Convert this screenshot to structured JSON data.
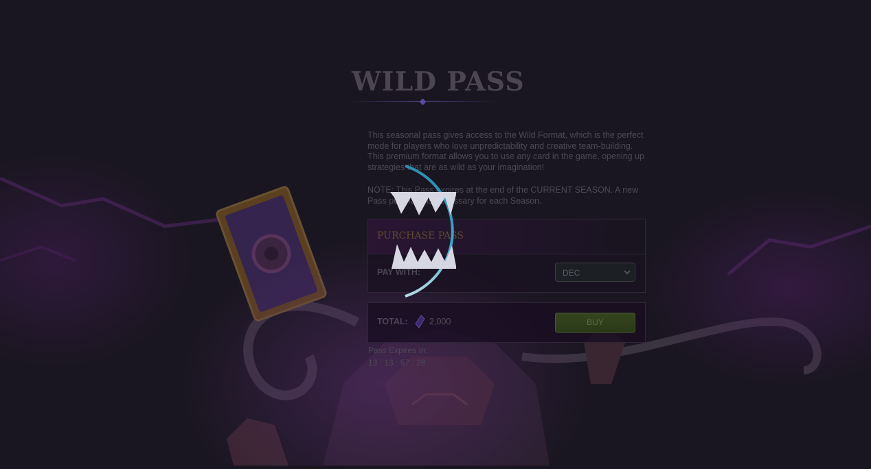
{
  "page": {
    "title": "WILD PASS",
    "description": "This seasonal pass gives access to the Wild Format, which is the perfect mode for players who love unpredictability and creative team-building. This premium format allows you to use any card in the game, opening up strategies that are as wild as your imagination!",
    "note": "NOTE: This Pass expires at the end of the CURRENT SEASON. A new Pass purchase is necessary for each Season."
  },
  "purchase": {
    "header": "PURCHASE PASS",
    "pay_with_label": "PAY WITH:",
    "currency_selected": "DEC"
  },
  "total": {
    "label": "TOTAL:",
    "amount": "2,000",
    "currency_icon": "dark-energy-crystal-icon",
    "buy_label": "BUY"
  },
  "expiry": {
    "label": "Pass Expires In:",
    "countdown": "13 : 13 : 57 : 28"
  },
  "loading": {
    "icon": "fanged-mouth-loading-spinner"
  },
  "colors": {
    "background": "#1a1621",
    "buy_button": "#34451f",
    "spinner_arc": "#3aa6c6",
    "header_accent": "#5e4a2e"
  }
}
